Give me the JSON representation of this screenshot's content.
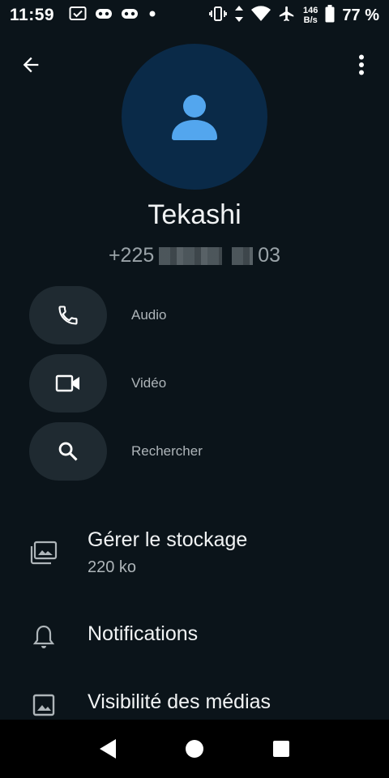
{
  "status_bar": {
    "time": "11:59",
    "net_speed_value": "146",
    "net_speed_unit": "B/s",
    "battery": "77 %",
    "icons": [
      "check-box-icon",
      "gamepad-icon",
      "gamepad-icon",
      "dot-icon",
      "vibrate-icon",
      "data-arrows-icon",
      "wifi-icon",
      "airplane-icon",
      "battery-icon"
    ]
  },
  "contact": {
    "name": "Tekashi",
    "phone_prefix": "+225",
    "phone_suffix": "03"
  },
  "actions": [
    {
      "label": "Audio",
      "icon": "phone-icon"
    },
    {
      "label": "Vidéo",
      "icon": "video-camera-icon"
    },
    {
      "label": "Rechercher",
      "icon": "search-icon"
    }
  ],
  "list": [
    {
      "title": "Gérer le stockage",
      "subtitle": "220 ko",
      "icon": "storage-folder-icon"
    },
    {
      "title": "Notifications",
      "icon": "bell-icon"
    },
    {
      "title": "Visibilité des médias",
      "icon": "image-icon"
    }
  ],
  "colors": {
    "background": "#0b141a",
    "avatar_bg": "#0a2a48",
    "avatar_fg": "#53a6ee",
    "pill_bg": "#1f2a31"
  }
}
